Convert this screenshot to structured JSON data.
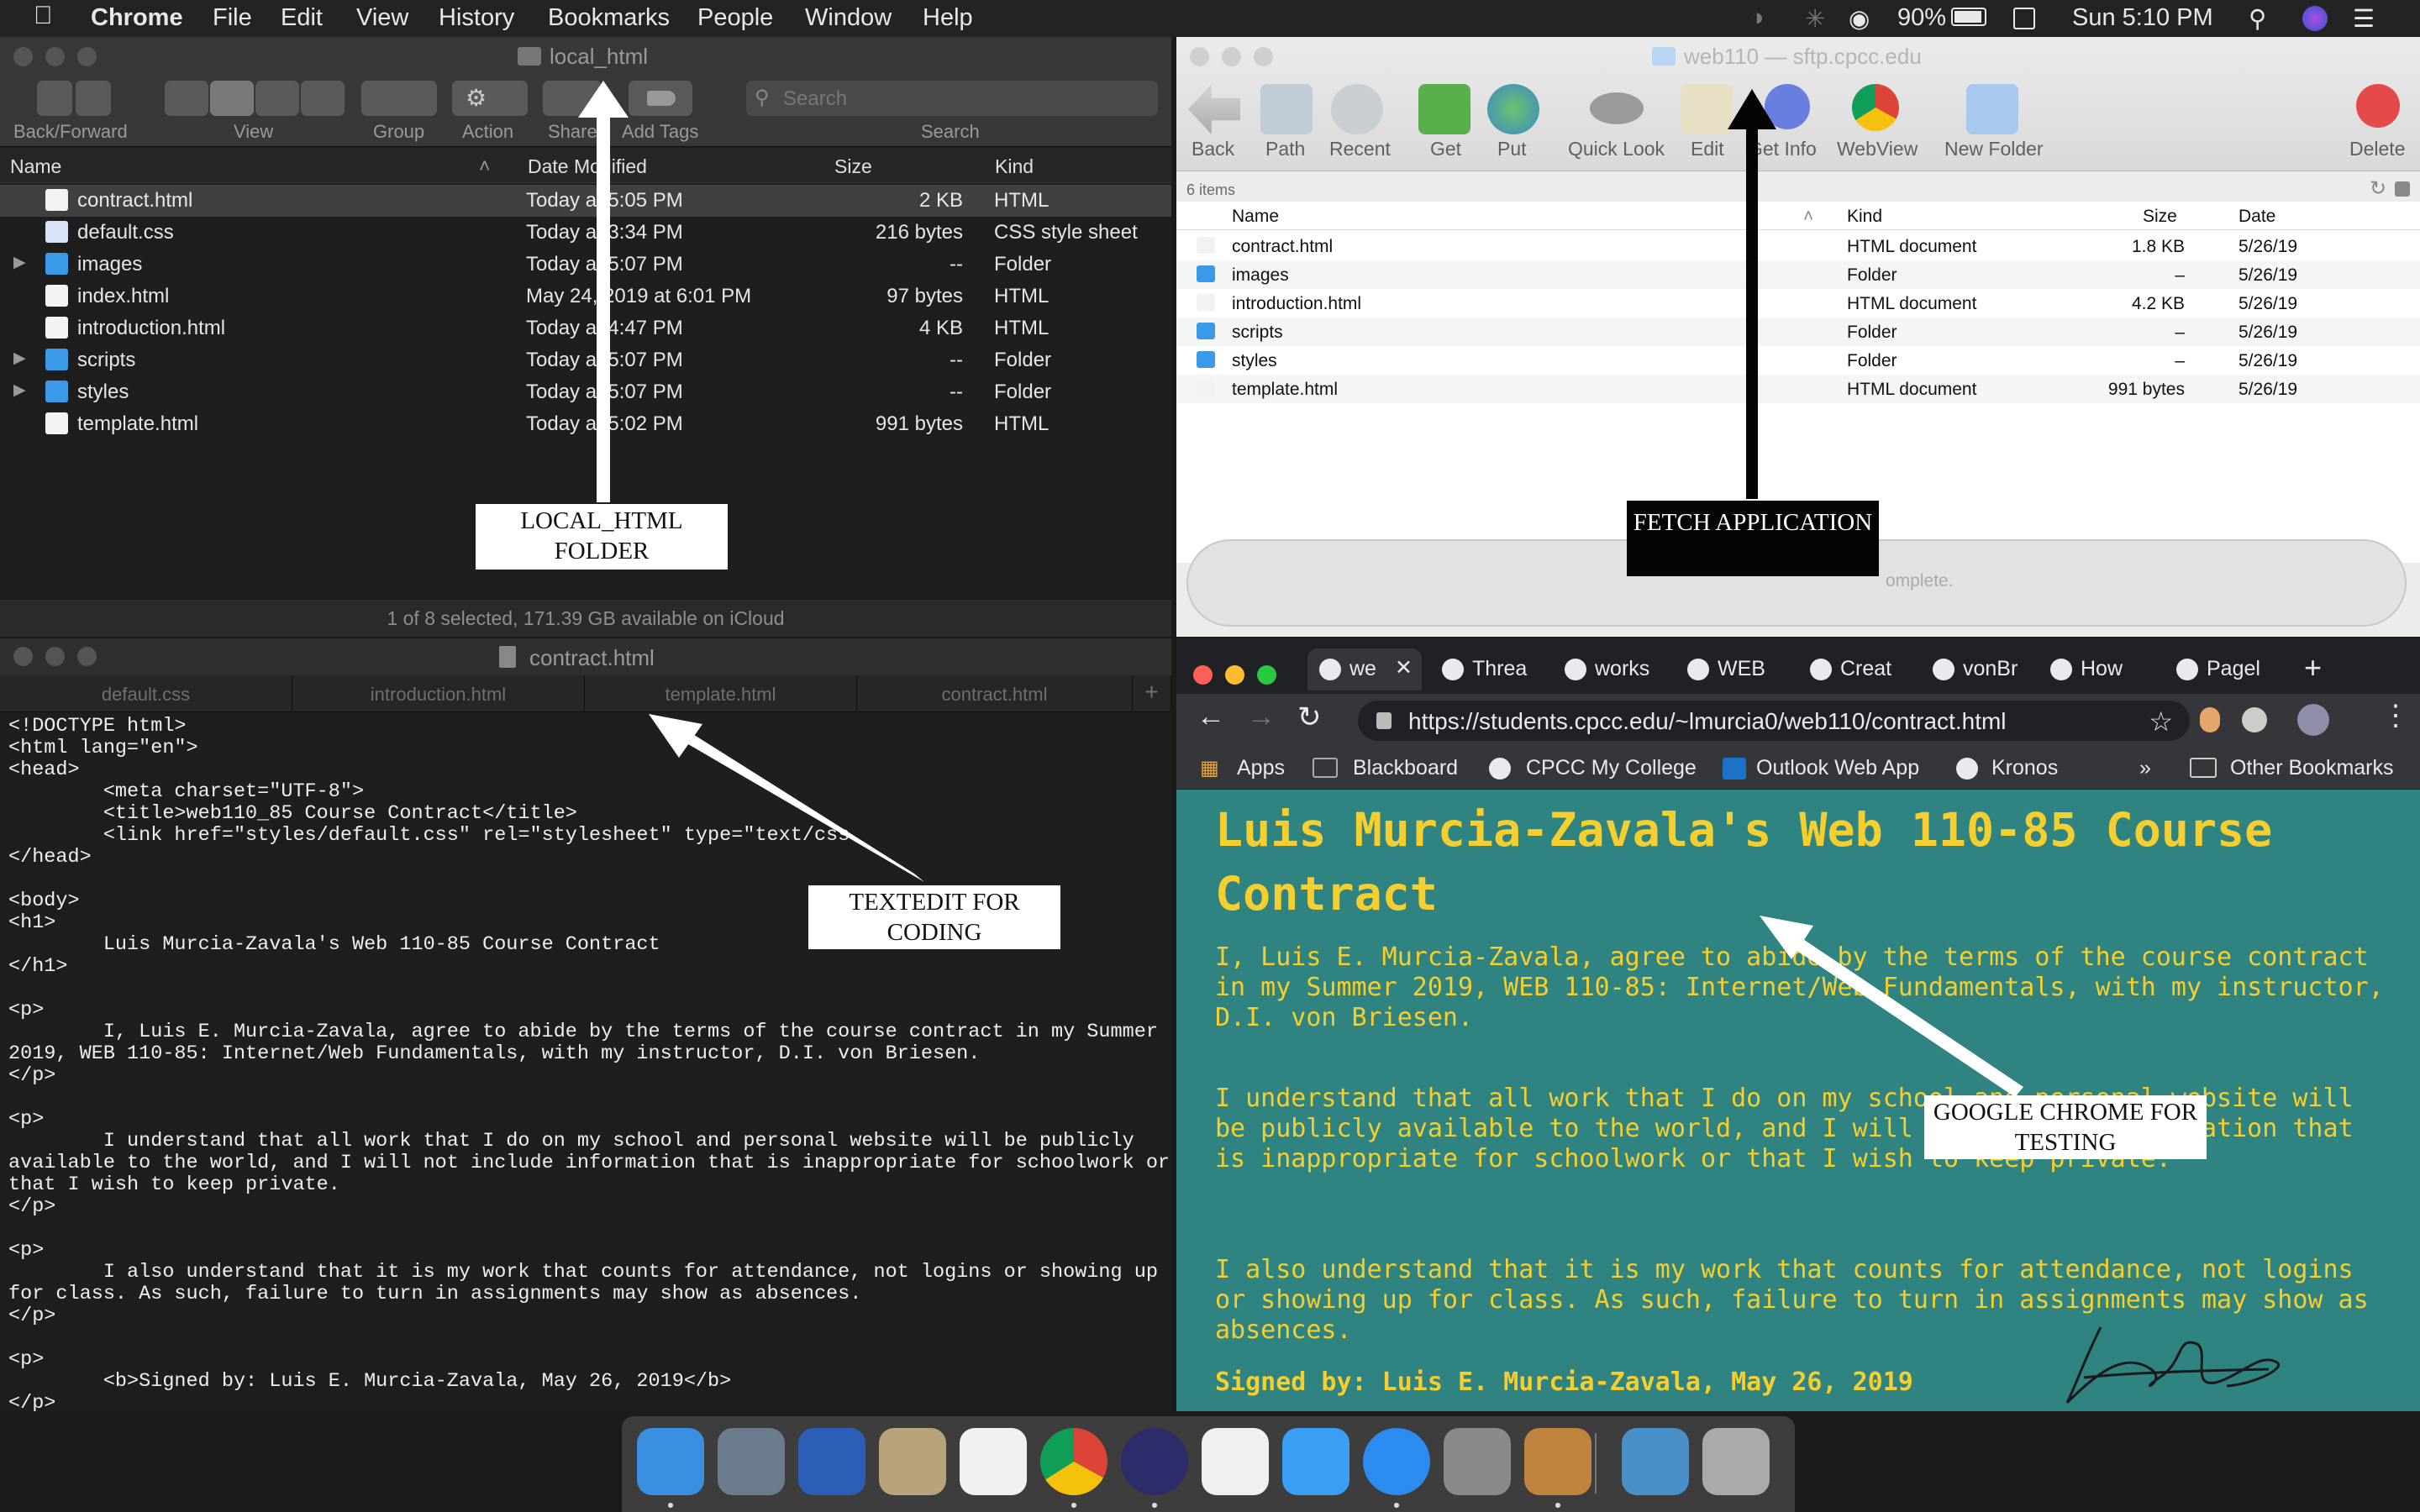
{
  "menubar": {
    "app": "Chrome",
    "items": [
      "File",
      "Edit",
      "View",
      "History",
      "Bookmarks",
      "People",
      "Window",
      "Help"
    ],
    "battery": "90%",
    "clock": "Sun 5:10 PM"
  },
  "finder": {
    "title": "local_html",
    "toolbar_labels": {
      "back": "Back/Forward",
      "view": "View",
      "group": "Group",
      "action": "Action",
      "share": "Share",
      "tags": "Add Tags",
      "search": "Search"
    },
    "search_placeholder": "Search",
    "columns": [
      "Name",
      "Date Modified",
      "Size",
      "Kind"
    ],
    "rows": [
      {
        "name": "contract.html",
        "date": "Today at 5:05 PM",
        "size": "2 KB",
        "kind": "HTML",
        "icon": "chrome-doc-icon"
      },
      {
        "name": "default.css",
        "date": "Today at 3:34 PM",
        "size": "216 bytes",
        "kind": "CSS style sheet",
        "icon": "css-doc-icon"
      },
      {
        "name": "images",
        "date": "Today at 5:07 PM",
        "size": "--",
        "kind": "Folder",
        "icon": "folder-icon"
      },
      {
        "name": "index.html",
        "date": "May 24, 2019 at 6:01 PM",
        "size": "97 bytes",
        "kind": "HTML",
        "icon": "chrome-doc-icon"
      },
      {
        "name": "introduction.html",
        "date": "Today at 4:47 PM",
        "size": "4 KB",
        "kind": "HTML",
        "icon": "chrome-doc-icon"
      },
      {
        "name": "scripts",
        "date": "Today at 5:07 PM",
        "size": "--",
        "kind": "Folder",
        "icon": "folder-icon"
      },
      {
        "name": "styles",
        "date": "Today at 5:07 PM",
        "size": "--",
        "kind": "Folder",
        "icon": "folder-icon"
      },
      {
        "name": "template.html",
        "date": "Today at 5:02 PM",
        "size": "991 bytes",
        "kind": "HTML",
        "icon": "chrome-doc-icon"
      }
    ],
    "status": "1 of 8 selected, 171.39 GB available on iCloud"
  },
  "fetch": {
    "title": "web110 — sftp.cpcc.edu",
    "toolbar": {
      "back": "Back",
      "path": "Path",
      "recent": "Recent",
      "get": "Get",
      "put": "Put",
      "quicklook": "Quick Look",
      "edit": "Edit",
      "getinfo": "Get Info",
      "webview": "WebView",
      "newfolder": "New Folder",
      "delete": "Delete"
    },
    "item_count": "6 items",
    "columns": [
      "Name",
      "Kind",
      "Size",
      "Date"
    ],
    "rows": [
      {
        "name": "contract.html",
        "kind": "HTML document",
        "size": "1.8 KB",
        "date": "5/26/19",
        "icon": "chrome-doc-icon"
      },
      {
        "name": "images",
        "kind": "Folder",
        "size": "–",
        "date": "5/26/19",
        "icon": "folder-icon"
      },
      {
        "name": "introduction.html",
        "kind": "HTML document",
        "size": "4.2 KB",
        "date": "5/26/19",
        "icon": "chrome-doc-icon"
      },
      {
        "name": "scripts",
        "kind": "Folder",
        "size": "–",
        "date": "5/26/19",
        "icon": "folder-icon"
      },
      {
        "name": "styles",
        "kind": "Folder",
        "size": "–",
        "date": "5/26/19",
        "icon": "folder-icon"
      },
      {
        "name": "template.html",
        "kind": "HTML document",
        "size": "991 bytes",
        "date": "5/26/19",
        "icon": "chrome-doc-icon"
      }
    ],
    "transfer_status": "omplete."
  },
  "textedit": {
    "title": "contract.html",
    "tabs": [
      "default.css",
      "introduction.html",
      "template.html",
      "contract.html"
    ],
    "code": "<!DOCTYPE html>\n<html lang=\"en\">\n<head>\n        <meta charset=\"UTF-8\">\n        <title>web110_85 Course Contract</title>\n        <link href=\"styles/default.css\" rel=\"stylesheet\" type=\"text/css\n</head>\n\n<body>\n<h1>\n        Luis Murcia-Zavala's Web 110-85 Course Contract\n</h1>\n\n<p>\n        I, Luis E. Murcia-Zavala, agree to abide by the terms of the course contract in my Summer\n2019, WEB 110-85: Internet/Web Fundamentals, with my instructor, D.I. von Briesen.\n</p>\n\n<p>\n        I understand that all work that I do on my school and personal website will be publicly\navailable to the world, and I will not include information that is inappropriate for schoolwork or\nthat I wish to keep private.\n</p>\n\n<p>\n        I also understand that it is my work that counts for attendance, not logins or showing up\nfor class. As such, failure to turn in assignments may show as absences.\n</p>\n\n<p>\n        <b>Signed by: Luis E. Murcia-Zavala, May 26, 2019</b>\n</p>"
  },
  "chrome": {
    "tabs": [
      "we",
      "Threa",
      "works",
      "WEB",
      "Creat",
      "vonBr",
      "How",
      "Pagel"
    ],
    "url": "https://students.cpcc.edu/~lmurcia0/web110/contract.html",
    "bookmarks": [
      "Apps",
      "Blackboard",
      "CPCC My College",
      "Outlook Web App",
      "Kronos"
    ],
    "other_bookmarks": "Other Bookmarks",
    "overflow": "»",
    "page": {
      "h1": "Luis Murcia-Zavala's Web 110-85 Course Contract",
      "p1": "I, Luis E. Murcia-Zavala, agree to abide by the terms of the course contract in my Summer 2019, WEB 110-85: Internet/Web Fundamentals, with my instructor, D.I. von Briesen.",
      "p2": "I understand that all work that I do on my school and personal website will be publicly available to the world, and I will not include information that is inappropriate for schoolwork or that I wish to keep private.",
      "p3": "I also understand that it is my work that counts for attendance, not logins or showing up for class. As such, failure to turn in assignments may show as absences.",
      "signed": "Signed by: Luis E. Murcia-Zavala, May 26, 2019",
      "bg_color": "#2f8380",
      "text_color": "#f5ce30"
    }
  },
  "annotations": {
    "local": "LOCAL_HTML FOLDER",
    "fetch": "FETCH APPLICATION",
    "textedit": "TEXTEDIT FOR CODING",
    "chrome": "GOOGLE CHROME FOR TESTING"
  },
  "dock": [
    "finder-icon",
    "launchpad-icon",
    "word-icon",
    "preview-icon",
    "textedit-icon",
    "chrome-icon",
    "siri-icon",
    "itunes-icon",
    "messages-icon",
    "zoom-icon",
    "system-preferences-icon",
    "fetch-dog-icon",
    "downloads-icon",
    "trash-icon"
  ]
}
